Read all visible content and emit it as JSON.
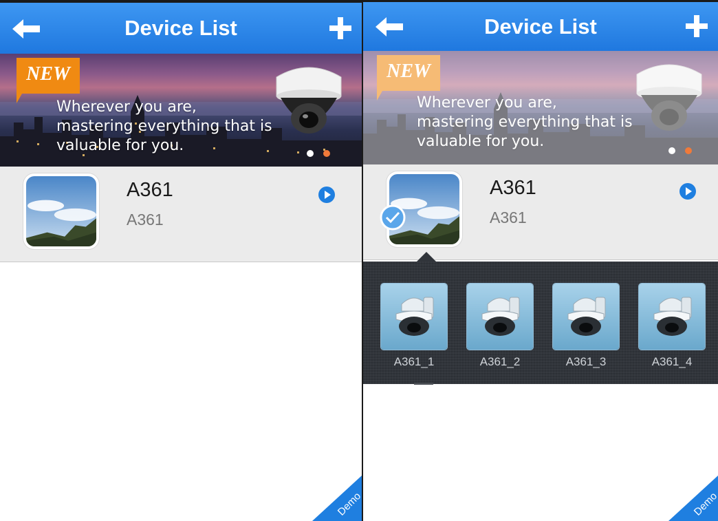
{
  "colors": {
    "accent": "#2585e8",
    "new_badge": "#f08a12",
    "carousel_dot_inactive": "#f07a3a",
    "row_background": "#ebebeb",
    "panel_background": "#30343a"
  },
  "screens": [
    {
      "navbar": {
        "title": "Device List",
        "back_icon": "arrow-left-icon",
        "add_icon": "plus-icon"
      },
      "banner": {
        "badge": "NEW",
        "lines": [
          "Wherever you are,",
          "mastering everything that is",
          "valuable for you."
        ],
        "carousel_active_index": 0,
        "carousel_count": 2
      },
      "device": {
        "name": "A361",
        "subtitle": "A361",
        "play_icon": "play-circle-icon"
      },
      "demo_label": "Demo"
    },
    {
      "navbar": {
        "title": "Device List",
        "back_icon": "arrow-left-icon",
        "add_icon": "plus-icon"
      },
      "banner": {
        "badge": "NEW",
        "lines": [
          "Wherever you are,",
          "mastering everything that is",
          "valuable for you."
        ],
        "carousel_active_index": 0,
        "carousel_count": 2
      },
      "device": {
        "name": "A361",
        "subtitle": "A361",
        "play_icon": "play-circle-icon",
        "selected": true
      },
      "cameras": [
        {
          "label": "A361_1"
        },
        {
          "label": "A361_2"
        },
        {
          "label": "A361_3"
        },
        {
          "label": "A361_4"
        }
      ],
      "demo_label": "Demo"
    }
  ]
}
